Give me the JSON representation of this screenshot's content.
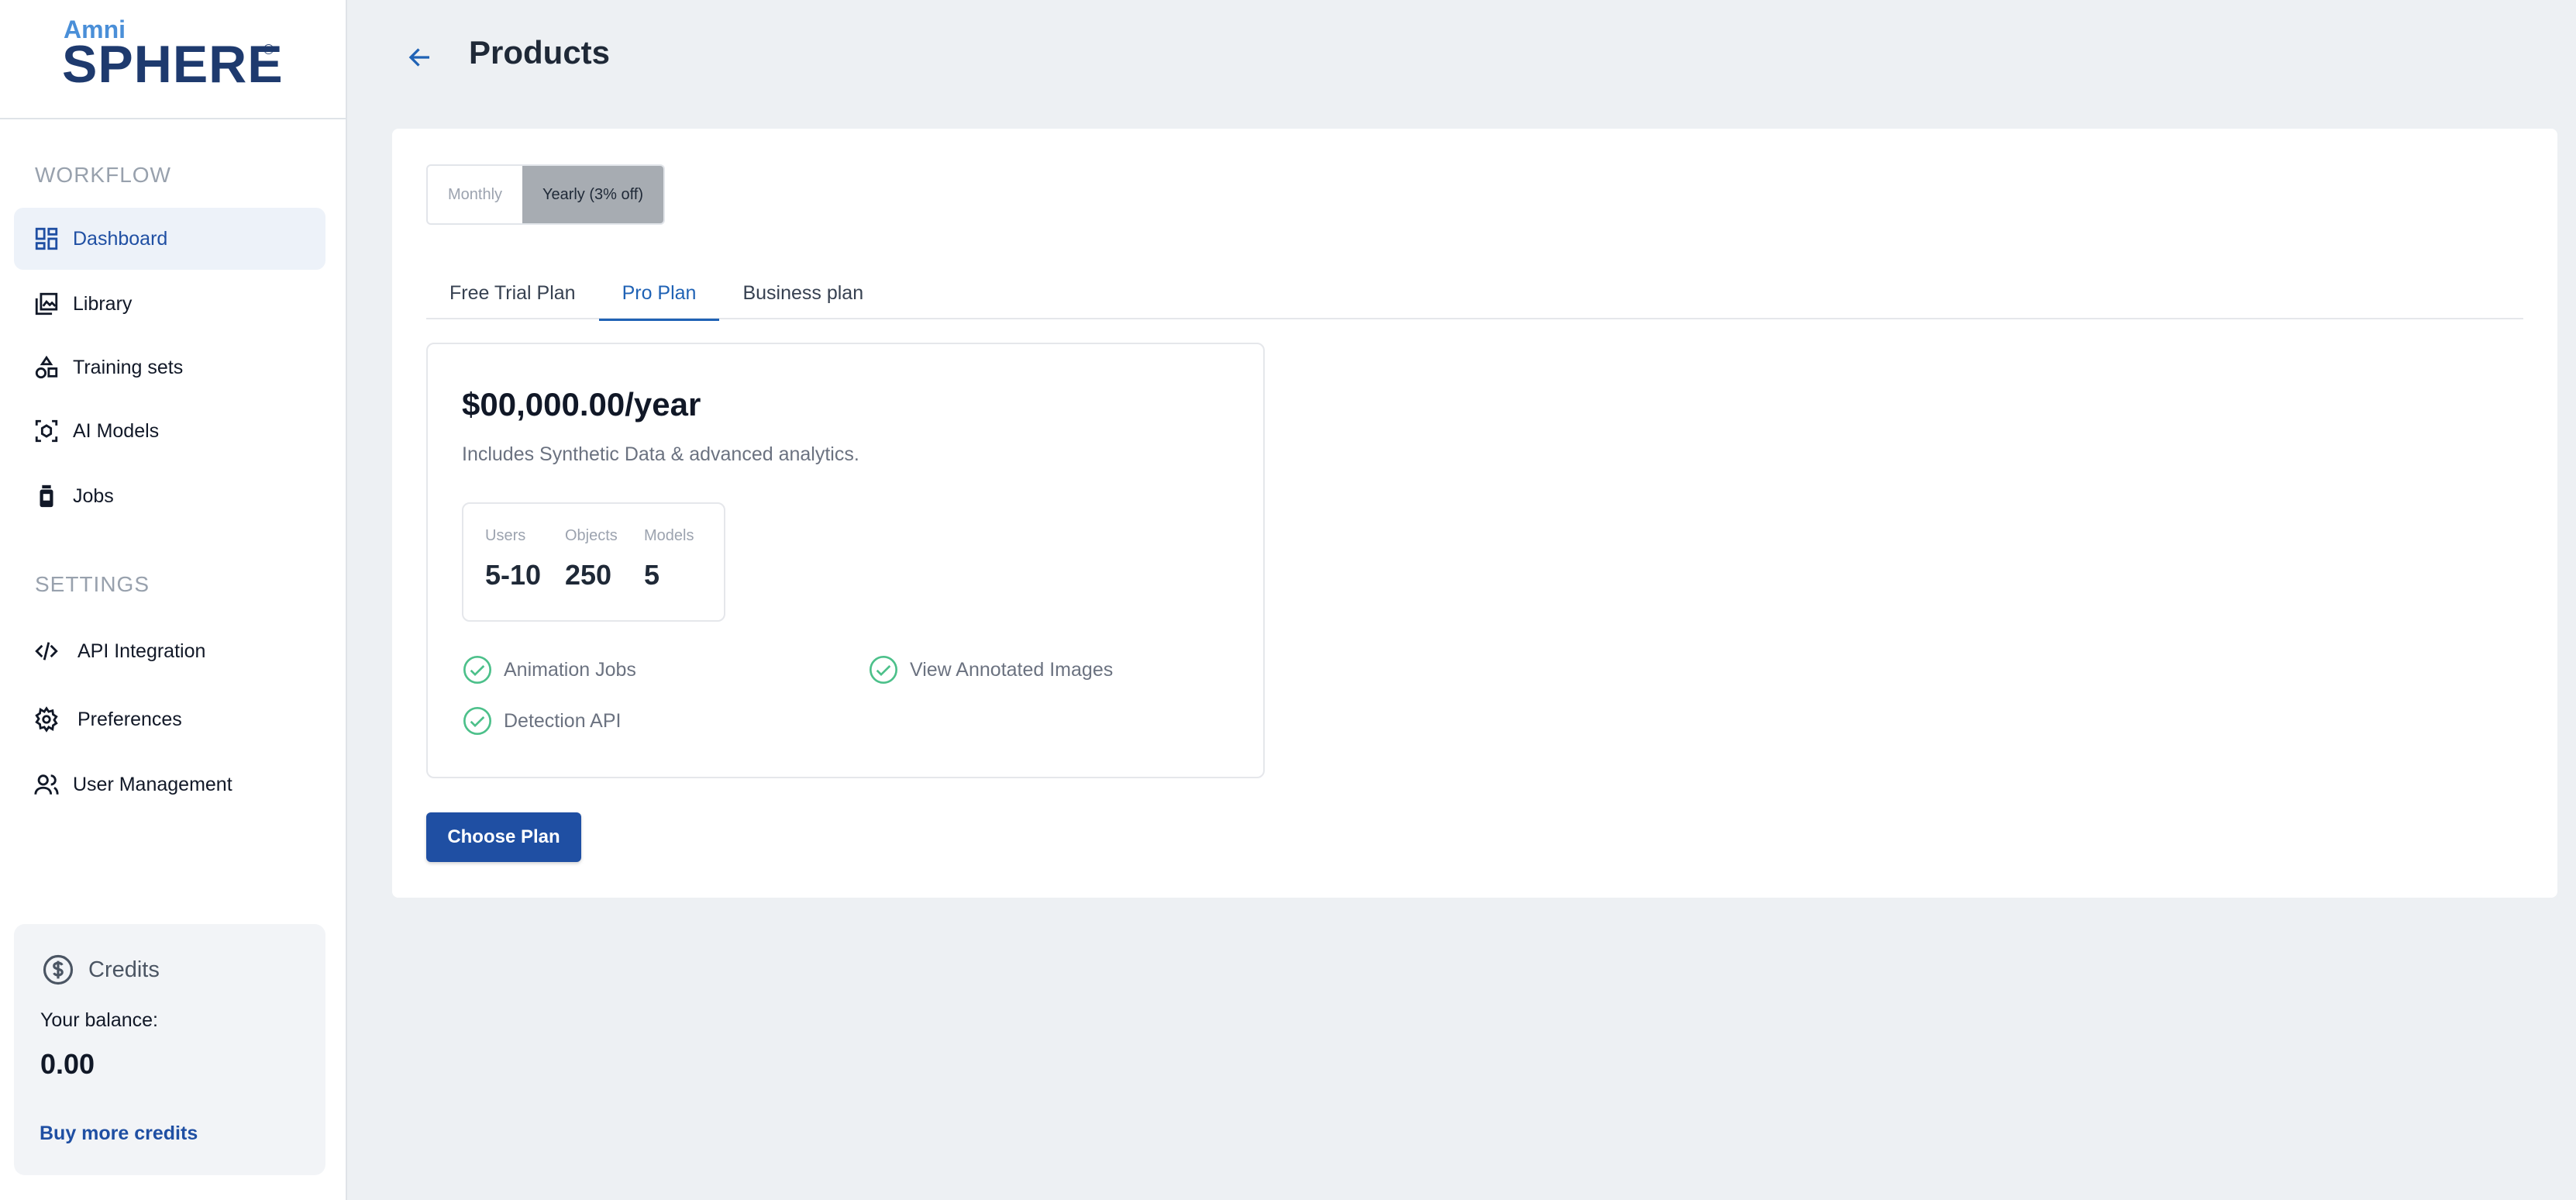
{
  "brand": {
    "line1": "Amni",
    "line2": "SPHERE",
    "mark": "®"
  },
  "sidebar": {
    "workflow_label": "WORKFLOW",
    "settings_label": "SETTINGS",
    "workflow_items": [
      {
        "label": "Dashboard",
        "icon": "dashboard-icon",
        "active": true
      },
      {
        "label": "Library",
        "icon": "library-icon"
      },
      {
        "label": "Training sets",
        "icon": "shapes-icon"
      },
      {
        "label": "AI Models",
        "icon": "ai-model-icon"
      },
      {
        "label": "Jobs",
        "icon": "jobs-icon"
      }
    ],
    "settings_items": [
      {
        "label": "API Integration",
        "icon": "code-icon"
      },
      {
        "label": "Preferences",
        "icon": "gear-icon"
      },
      {
        "label": "User Management",
        "icon": "users-icon"
      }
    ],
    "credits": {
      "title": "Credits",
      "balance_label": "Your balance:",
      "balance": "0.00",
      "buy_link": "Buy more credits"
    }
  },
  "header": {
    "title": "Products"
  },
  "billing_toggle": {
    "monthly": "Monthly",
    "yearly": "Yearly (3% off)",
    "selected": "yearly"
  },
  "tabs": [
    {
      "label": "Free Trial Plan"
    },
    {
      "label": "Pro Plan",
      "active": true
    },
    {
      "label": "Business plan"
    }
  ],
  "plan": {
    "price": "$00,000.00/year",
    "description": "Includes Synthetic Data & advanced analytics.",
    "stats": [
      {
        "label": "Users",
        "value": "5-10"
      },
      {
        "label": "Objects",
        "value": "250"
      },
      {
        "label": "Models",
        "value": "5"
      }
    ],
    "features": [
      "Animation Jobs",
      "View Annotated Images",
      "Detection API"
    ]
  },
  "cta": {
    "label": "Choose Plan"
  },
  "colors": {
    "primary": "#1f4fa3",
    "active_tab": "#1f62b5",
    "check": "#4cc08a",
    "background": "#edf0f3"
  }
}
